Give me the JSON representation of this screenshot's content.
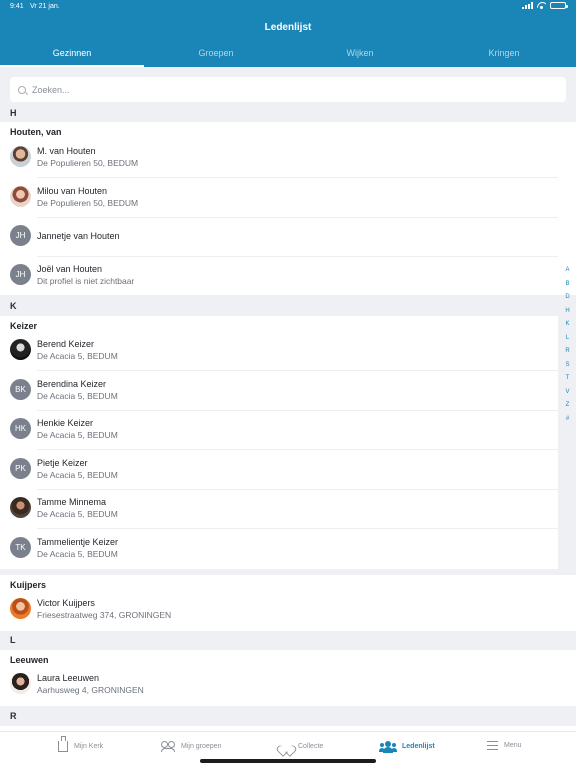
{
  "status_bar": {
    "time": "9:41",
    "date": "Vr 21 jan."
  },
  "header": {
    "title": "Ledenlijst"
  },
  "tabs": [
    {
      "label": "Gezinnen",
      "active": true
    },
    {
      "label": "Groepen",
      "active": false
    },
    {
      "label": "Wijken",
      "active": false
    },
    {
      "label": "Kringen",
      "active": false
    }
  ],
  "search": {
    "placeholder": "Zoeken...",
    "value": ""
  },
  "sections": [
    {
      "letter": "H",
      "families": [
        {
          "name": "Houten, van",
          "members": [
            {
              "name": "M. van Houten",
              "address": "De Populieren 50, BEDUM",
              "avatar": "photo"
            },
            {
              "name": "Milou van Houten",
              "address": "De Populieren 50, BEDUM",
              "avatar": "photo"
            },
            {
              "name": "Jannetje van Houten",
              "address": "",
              "initials": "JH"
            },
            {
              "name": "Joël van Houten",
              "address": "Dit profiel is niet zichtbaar",
              "initials": "JH"
            }
          ]
        }
      ]
    },
    {
      "letter": "K",
      "families": [
        {
          "name": "Keizer",
          "members": [
            {
              "name": "Berend Keizer",
              "address": "De Acacia 5, BEDUM",
              "avatar": "photo"
            },
            {
              "name": "Berendina Keizer",
              "address": "De Acacia 5, BEDUM",
              "initials": "BK"
            },
            {
              "name": "Henkie Keizer",
              "address": "De Acacia 5, BEDUM",
              "initials": "HK"
            },
            {
              "name": "Pietje Keizer",
              "address": "De Acacia 5, BEDUM",
              "initials": "PK"
            },
            {
              "name": "Tamme Minnema",
              "address": "De Acacia 5, BEDUM",
              "avatar": "photo"
            },
            {
              "name": "Tammelientje Keizer",
              "address": "De Acacia 5, BEDUM",
              "initials": "TK"
            }
          ]
        },
        {
          "name": "Kuijpers",
          "members": [
            {
              "name": "Victor Kuijpers",
              "address": "Friesestraatweg 374, GRONINGEN",
              "avatar": "photo"
            }
          ]
        }
      ]
    },
    {
      "letter": "L",
      "families": [
        {
          "name": "Leeuwen",
          "members": [
            {
              "name": "Laura Leeuwen",
              "address": "Aarhusweg 4, GRONINGEN",
              "avatar": "photo"
            }
          ]
        }
      ]
    },
    {
      "letter": "R",
      "families": []
    }
  ],
  "index_letters": [
    "A",
    "B",
    "D",
    "H",
    "K",
    "L",
    "R",
    "S",
    "T",
    "V",
    "Z",
    "#"
  ],
  "tabbar": [
    {
      "label": "Mijn Kerk",
      "icon": "church-icon",
      "active": false
    },
    {
      "label": "Mijn groepen",
      "icon": "groups-icon",
      "active": false
    },
    {
      "label": "Collecte",
      "icon": "heart-icon",
      "active": false
    },
    {
      "label": "Ledenlijst",
      "icon": "people-icon",
      "active": true
    },
    {
      "label": "Menu",
      "icon": "menu-icon",
      "active": false
    }
  ],
  "colors": {
    "brand": "#1a86b8",
    "background": "#eef0f4",
    "avatar_placeholder": "#7a818c"
  }
}
